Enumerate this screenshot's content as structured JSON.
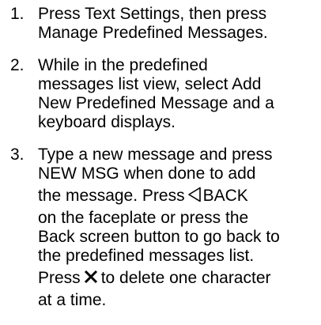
{
  "steps": [
    {
      "number": "1.",
      "lines": [
        "Press Text Settings, then press",
        "Manage Predefined Messages."
      ]
    },
    {
      "number": "2.",
      "lines": [
        "While in the predefined",
        "messages list view, select Add",
        "New Predefined Message and a",
        "keyboard displays."
      ]
    },
    {
      "number": "3.",
      "lines": [
        "Type a new message and press",
        "NEW MSG when done to add",
        "the message. Press",
        "BACK",
        "on the faceplate or press the",
        "Back screen button to go back to",
        "the predefined messages list.",
        "Press",
        "to delete one character",
        "at a time."
      ],
      "icons": [
        "back-triangle-icon",
        "x-delete-icon"
      ]
    }
  ]
}
